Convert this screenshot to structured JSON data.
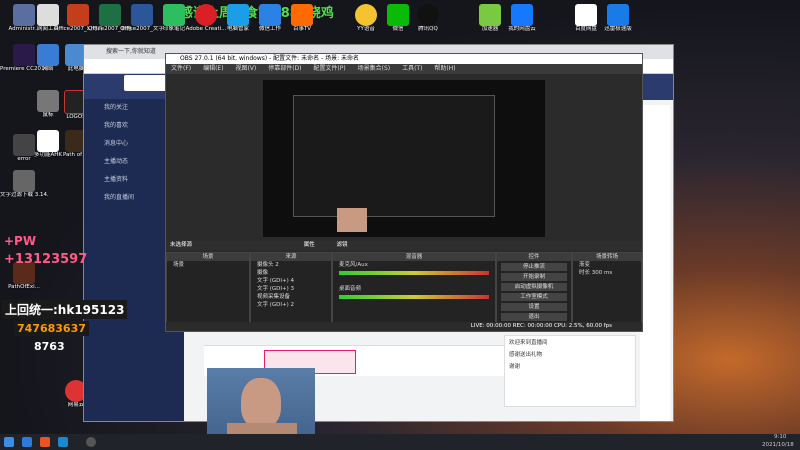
{
  "overlay": {
    "top_text": "感谢上周超食官: 888烧鸡",
    "pw_text": "+PW",
    "phone": "+13123597",
    "contact": "上回统一:hk195123",
    "qq": "747683637",
    "code": "8763"
  },
  "desktop_icons_left": [
    "Administr...",
    "Premiere CC2019",
    "error",
    "文字过滤下载 3.14.0(3.1...",
    "PathOfExi..."
  ],
  "desktop_icons_col2": [
    "网络",
    "鼠标",
    "多功能AHK"
  ],
  "desktop_icons_col3": [
    "此电脑",
    "LOGOS",
    "Path of ...",
    "网易云"
  ],
  "desktop_icons_top": [
    "网阅工具",
    "Office2007_幻灯片PPT",
    "Office2007_表格",
    "Office2007_文字",
    "印象笔记",
    "Adobe Creati...",
    "电脑管家",
    "微信工作",
    "百事TV",
    "YY语音",
    "微信",
    "腾讯QQ",
    "",
    "加速器",
    "我的网盘云",
    "",
    "迅雷",
    "百度网盘",
    "迅雷极速版"
  ],
  "browser": {
    "tab1": "搜索一下,你就知道",
    "sidebar": [
      "我的关注",
      "我的喜欢",
      "消息中心",
      "主播动态",
      "主播资料",
      "我的直播间"
    ],
    "badge": "Lv.1 24"
  },
  "obs": {
    "title": "OBS 27.0.1 (64 bit, windows) - 配置文件: 未命名 - 场景: 未命名",
    "menu": [
      "文件(F)",
      "编辑(E)",
      "视图(V)",
      "停靠部件(D)",
      "配置文件(P)",
      "场景集合(S)",
      "工具(T)",
      "帮助(H)"
    ],
    "status_bar_label": "未选择源",
    "toolbar": [
      "属性",
      "滤镜"
    ],
    "docks": {
      "scenes": "场景",
      "sources": "来源",
      "mixer": "混音器",
      "controls": "控件",
      "transitions": "场景转场"
    },
    "scene_items": [
      "场景"
    ],
    "sources": [
      "摄像头 2",
      "摄像",
      "文字 (GDI+) 4",
      "文字 (GDI+) 3",
      "视频采集设备",
      "文字 (GDI+) 2"
    ],
    "mixer": [
      "麦克风/Aux",
      "桌面音频"
    ],
    "controls": [
      "停止推流",
      "开始录制",
      "启动虚拟摄像机",
      "工作室模式",
      "设置",
      "退出"
    ],
    "transition": {
      "type": "渐变",
      "duration_label": "时长",
      "duration": "300 ms"
    },
    "status": "LIVE: 00:00:00  REC: 00:00:00  CPU: 2.5%, 60.00 fps"
  },
  "chat": [
    "欢迎来到直播间",
    "感谢送出礼物",
    "谢谢"
  ],
  "taskbar": {
    "time": "9:10",
    "date": "2021/10/18"
  }
}
